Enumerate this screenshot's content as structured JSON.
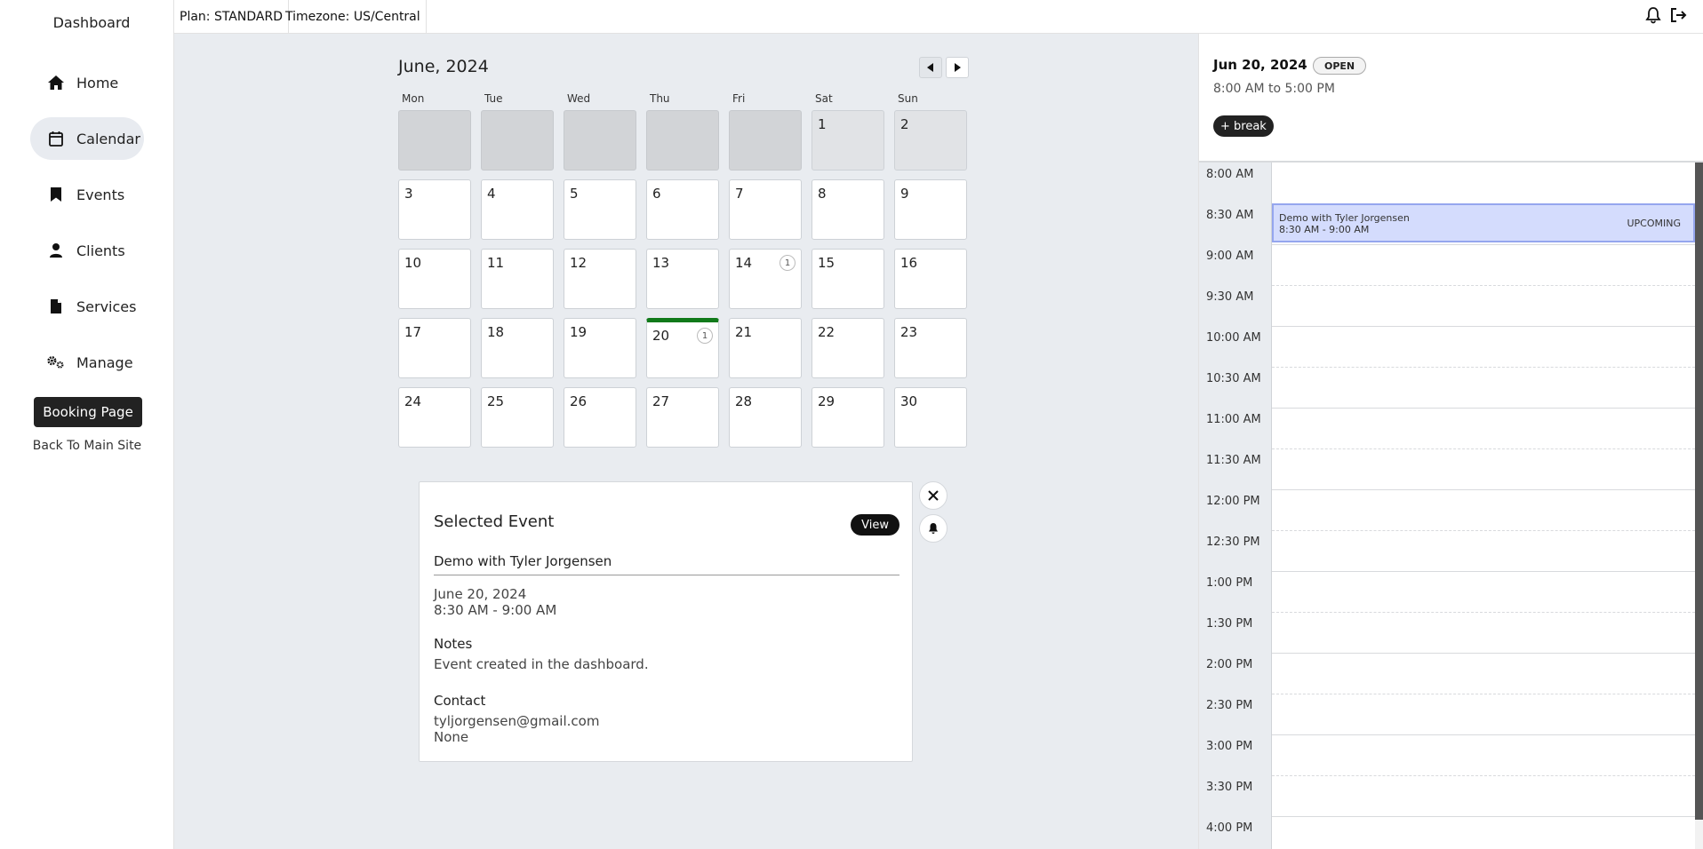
{
  "sidebar": {
    "title": "Dashboard",
    "items": [
      {
        "label": "Home",
        "icon": "home-icon"
      },
      {
        "label": "Calendar",
        "icon": "calendar-icon"
      },
      {
        "label": "Events",
        "icon": "bookmark-icon"
      },
      {
        "label": "Clients",
        "icon": "person-icon"
      },
      {
        "label": "Services",
        "icon": "file-icon"
      },
      {
        "label": "Manage",
        "icon": "gears-icon"
      }
    ],
    "booking_label": "Booking Page",
    "back_label": "Back To Main Site"
  },
  "topbar": {
    "plan": "Plan: STANDARD",
    "timezone": "Timezone: US/Central"
  },
  "calendar": {
    "title": "June, 2024",
    "dow": [
      "Mon",
      "Tue",
      "Wed",
      "Thu",
      "Fri",
      "Sat",
      "Sun"
    ],
    "days": [
      {
        "n": "",
        "kind": "blank"
      },
      {
        "n": "",
        "kind": "blank"
      },
      {
        "n": "",
        "kind": "blank"
      },
      {
        "n": "",
        "kind": "blank"
      },
      {
        "n": "",
        "kind": "blank"
      },
      {
        "n": "1",
        "kind": "weekend-pre"
      },
      {
        "n": "2",
        "kind": "weekend-pre"
      },
      {
        "n": "3"
      },
      {
        "n": "4"
      },
      {
        "n": "5"
      },
      {
        "n": "6"
      },
      {
        "n": "7"
      },
      {
        "n": "8"
      },
      {
        "n": "9"
      },
      {
        "n": "10"
      },
      {
        "n": "11"
      },
      {
        "n": "12"
      },
      {
        "n": "13"
      },
      {
        "n": "14",
        "badge": "1"
      },
      {
        "n": "15"
      },
      {
        "n": "16"
      },
      {
        "n": "17"
      },
      {
        "n": "18"
      },
      {
        "n": "19"
      },
      {
        "n": "20",
        "badge": "1",
        "today": true
      },
      {
        "n": "21"
      },
      {
        "n": "22"
      },
      {
        "n": "23"
      },
      {
        "n": "24"
      },
      {
        "n": "25"
      },
      {
        "n": "26"
      },
      {
        "n": "27"
      },
      {
        "n": "28"
      },
      {
        "n": "29"
      },
      {
        "n": "30"
      }
    ]
  },
  "selected_event": {
    "heading": "Selected Event",
    "view_label": "View",
    "name": "Demo with Tyler Jorgensen",
    "date": "June 20, 2024",
    "time": "8:30 AM - 9:00 AM",
    "notes_label": "Notes",
    "notes": "Event created in the dashboard.",
    "contact_label": "Contact",
    "email": "tyljorgensen@gmail.com",
    "phone": "None"
  },
  "day_panel": {
    "date": "Jun 20, 2024",
    "status": "OPEN",
    "hours": "8:00 AM to 5:00 PM",
    "break_label": "+ break",
    "slots": [
      "8:00 AM",
      "8:30 AM",
      "9:00 AM",
      "9:30 AM",
      "10:00 AM",
      "10:30 AM",
      "11:00 AM",
      "11:30 AM",
      "12:00 PM",
      "12:30 PM",
      "1:00 PM",
      "1:30 PM",
      "2:00 PM",
      "2:30 PM",
      "3:00 PM",
      "3:30 PM",
      "4:00 PM"
    ],
    "appointment": {
      "title": "Demo with Tyler Jorgensen",
      "time": "8:30 AM - 9:00 AM",
      "status": "UPCOMING"
    }
  },
  "colors": {
    "today_marker": "#117a1a",
    "appointment_bg": "#d4dcfd",
    "appointment_border": "#95a6ee"
  }
}
